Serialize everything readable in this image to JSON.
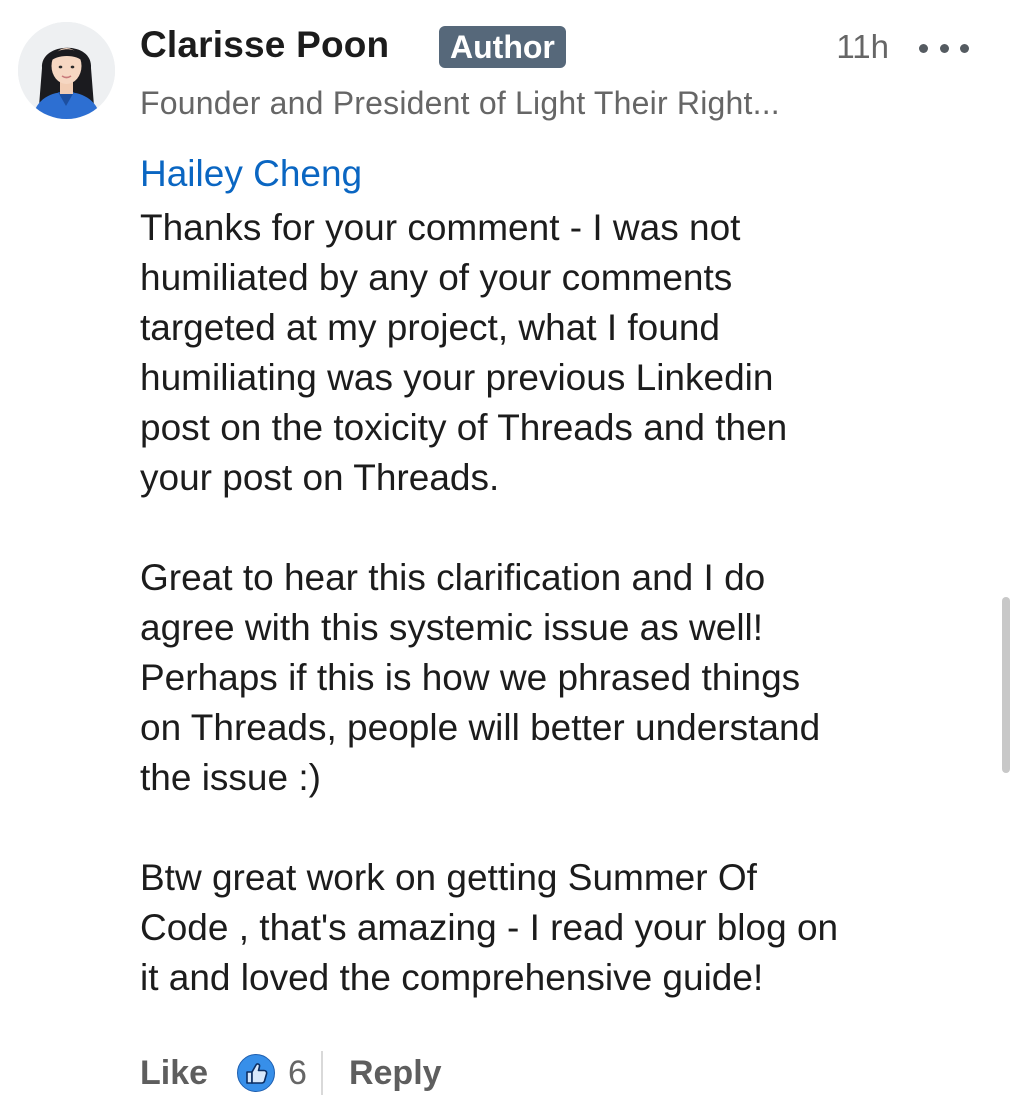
{
  "comment": {
    "author_name": "Clarisse Poon",
    "author_badge": "Author",
    "timestamp": "11h",
    "headline": "Founder and President of Light Their Right...",
    "mention": "Hailey Cheng",
    "paragraphs": [
      "Thanks for your comment - I was not\nhumiliated by any of your comments\ntargeted at my project, what I found\nhumiliating was your previous Linkedin\npost on the toxicity of Threads and then\nyour post on Threads.",
      "Great to hear this clarification and I do\nagree with this systemic issue as well!\nPerhaps if this is how we phrased things\non Threads, people will better understand\nthe issue :)",
      "Btw great work on getting Summer Of\nCode , that's amazing - I read your blog on\nit and loved the comprehensive guide!"
    ]
  },
  "actions": {
    "like_label": "Like",
    "reaction_icon": "thumbs-up-icon",
    "reaction_count": "6",
    "reply_label": "Reply"
  },
  "icons": {
    "avatar": "avatar",
    "more": "more-horizontal-icon"
  },
  "colors": {
    "link": "#0a66c2",
    "badge_bg": "#56687a",
    "text": "#1c1c1c",
    "muted": "#666666",
    "like_blue": "#378fe9"
  }
}
